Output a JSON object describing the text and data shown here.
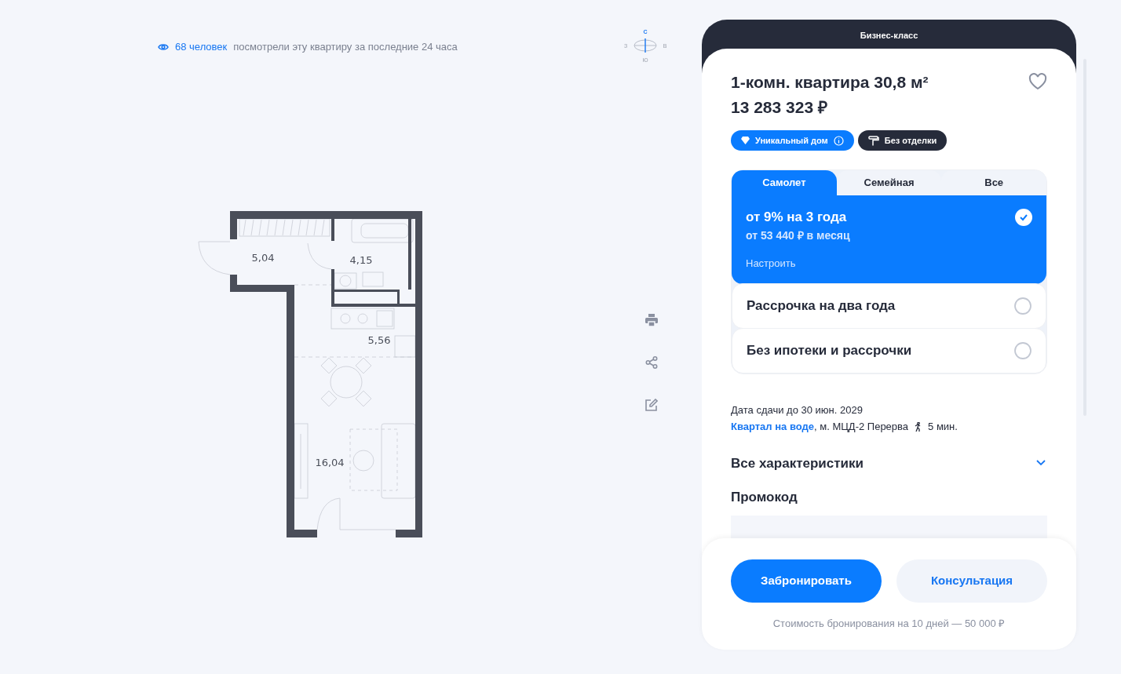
{
  "viewers": {
    "count": "68 человек",
    "text": "посмотрели  эту квартиру за последние 24 часа"
  },
  "compass": {
    "north": "С",
    "west": "З",
    "east": "В",
    "south": "Ю"
  },
  "floor_plan": {
    "rooms": [
      "5,04",
      "4,15",
      "5,56",
      "16,04"
    ]
  },
  "card": {
    "class_label": "Бизнес-класс",
    "title": "1-комн. квартира 30,8 м²",
    "price": "13 283 323 ₽",
    "favorite": false
  },
  "badges": [
    {
      "kind": "unique",
      "label": "Уникальный дом"
    },
    {
      "kind": "finish",
      "label": "Без отделки"
    }
  ],
  "tabs": [
    {
      "label": "Самолет",
      "selected": true
    },
    {
      "label": "Семейная",
      "selected": false
    },
    {
      "label": "Все",
      "selected": false
    }
  ],
  "offers": [
    {
      "title": "от 9% на 3 года",
      "subtitle": "от 53 440 ₽ в месяц",
      "action": "Настроить",
      "selected": true
    },
    {
      "title": "Рассрочка на два года",
      "selected": false
    },
    {
      "title": "Без ипотеки и рассрочки",
      "selected": false
    }
  ],
  "delivery": "Дата сдачи до 30 июн. 2029",
  "location": {
    "complex": "Квартал на воде",
    "metro": ", м. МЦД-2 Перерва",
    "walk": "5 мин."
  },
  "characteristics": {
    "label": "Все характеристики",
    "expanded": false
  },
  "promo": {
    "label": "Промокод"
  },
  "buttons": {
    "book": "Забронировать",
    "consult": "Консультация"
  },
  "booking_note": "Стоимость бронирования на 10 дней — 50 000 ₽"
}
